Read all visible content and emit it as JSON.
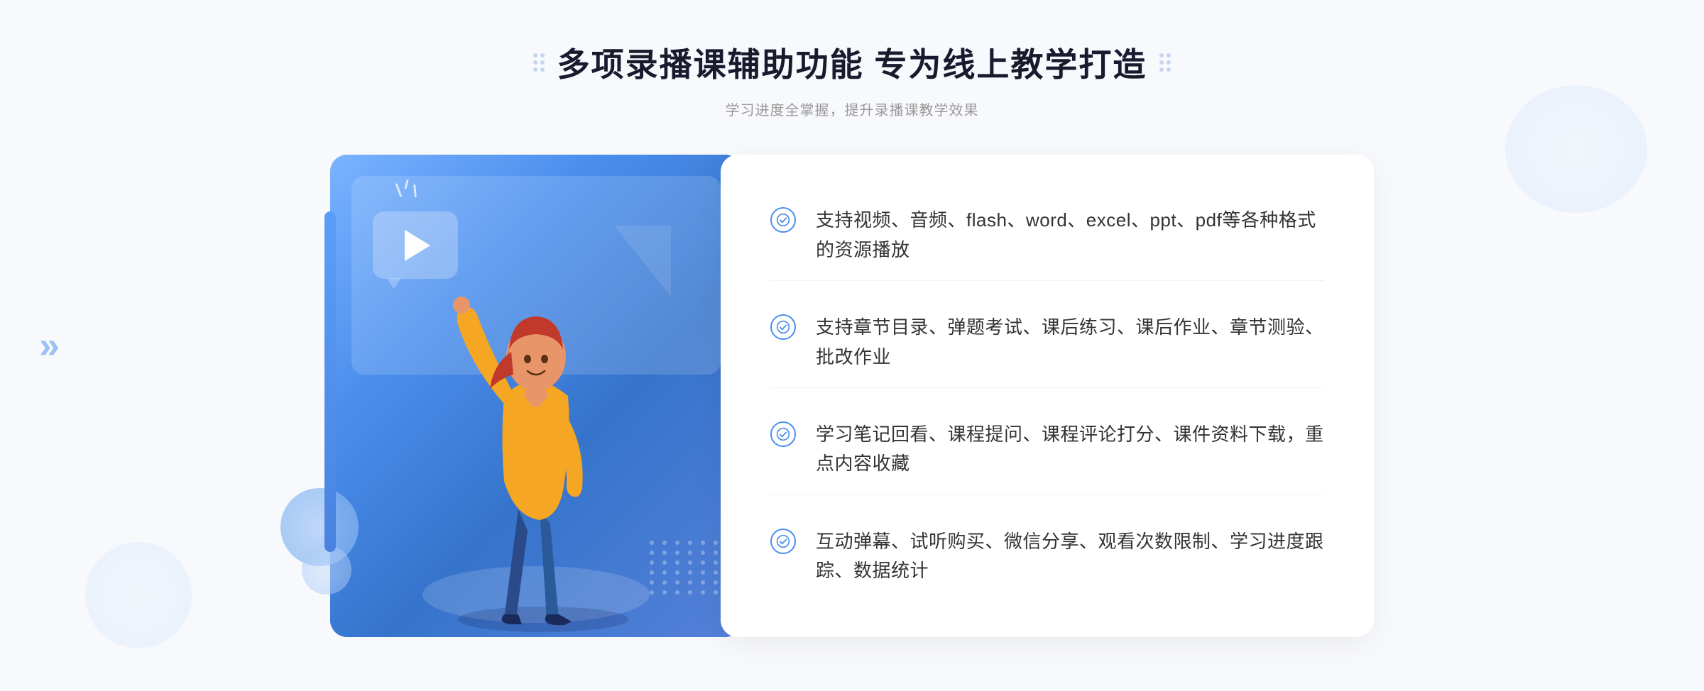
{
  "page": {
    "title": "多项录播课辅助功能 专为线上教学打造",
    "subtitle": "学习进度全掌握，提升录播课教学效果"
  },
  "header": {
    "title": "多项录播课辅助功能 专为线上教学打造",
    "subtitle": "学习进度全掌握，提升录播课教学效果"
  },
  "features": [
    {
      "id": 1,
      "text": "支持视频、音频、flash、word、excel、ppt、pdf等各种格式的资源播放"
    },
    {
      "id": 2,
      "text": "支持章节目录、弹题考试、课后练习、课后作业、章节测验、批改作业"
    },
    {
      "id": 3,
      "text": "学习笔记回看、课程提问、课程评论打分、课件资料下载，重点内容收藏"
    },
    {
      "id": 4,
      "text": "互动弹幕、试听购买、微信分享、观看次数限制、学习进度跟踪、数据统计"
    }
  ],
  "colors": {
    "primary_blue": "#4a8eed",
    "light_blue": "#7ab3ff",
    "dark_text": "#1a1a2e",
    "body_text": "#333333",
    "subtitle_text": "#999999",
    "bg": "#f8f9fc"
  },
  "icons": {
    "check": "check-circle-icon",
    "left_arrow": "chevron-left-icon",
    "play": "play-icon",
    "decor_dots": "decorative-dots-icon"
  }
}
